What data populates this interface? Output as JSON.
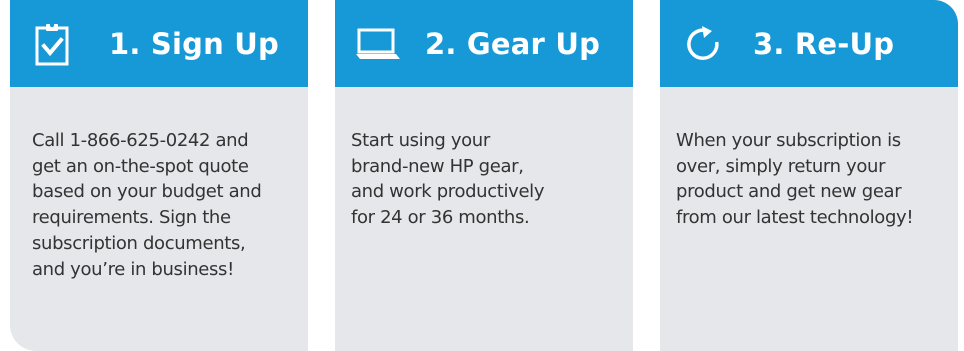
{
  "colors": {
    "header_blue": "#1699d6",
    "card_bg": "#e5e7ea",
    "body_text": "#333333",
    "header_text": "#ffffff"
  },
  "steps": [
    {
      "icon": "clipboard-check-icon",
      "title": "1. Sign Up",
      "body_lines": [
        "Call 1-866-625-0242 and",
        "get an on-the-spot quote",
        "based on your budget and",
        "requirements. Sign the",
        "subscription documents,",
        "and you’re in business!"
      ]
    },
    {
      "icon": "laptop-icon",
      "title": "2. Gear Up",
      "body_lines": [
        "Start using your",
        "brand-new HP gear,",
        "and work productively",
        "for 24 or 36 months."
      ]
    },
    {
      "icon": "refresh-icon",
      "title": "3. Re-Up",
      "body_lines": [
        "When your subscription is",
        "over, simply return your",
        "product and get new gear",
        "from our latest technology!"
      ]
    }
  ]
}
